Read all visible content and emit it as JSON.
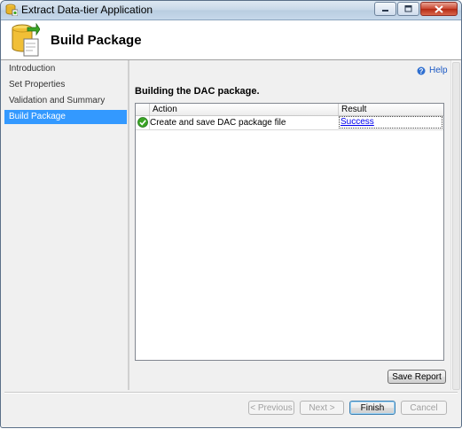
{
  "window": {
    "title": "Extract Data-tier Application",
    "app_icon": "database-app-icon",
    "controls": [
      "minimize-icon",
      "maximize-icon",
      "close-icon"
    ]
  },
  "header": {
    "title": "Build Package",
    "icon": "database-package-icon"
  },
  "sidebar": {
    "items": [
      {
        "label": "Introduction",
        "selected": false
      },
      {
        "label": "Set Properties",
        "selected": false
      },
      {
        "label": "Validation and Summary",
        "selected": false
      },
      {
        "label": "Build Package",
        "selected": true
      }
    ]
  },
  "main": {
    "help_label": "Help",
    "section_title": "Building the DAC package.",
    "grid": {
      "columns": [
        "Action",
        "Result"
      ],
      "rows": [
        {
          "status_icon": "success-check-icon",
          "action": "Create and save DAC package file",
          "result": "Success"
        }
      ]
    },
    "save_report_label": "Save Report"
  },
  "footer": {
    "previous_label": "< Previous",
    "next_label": "Next >",
    "finish_label": "Finish",
    "cancel_label": "Cancel"
  },
  "colors": {
    "selection": "#3399ff",
    "link": "#0000ee",
    "success": "#3aa524"
  }
}
